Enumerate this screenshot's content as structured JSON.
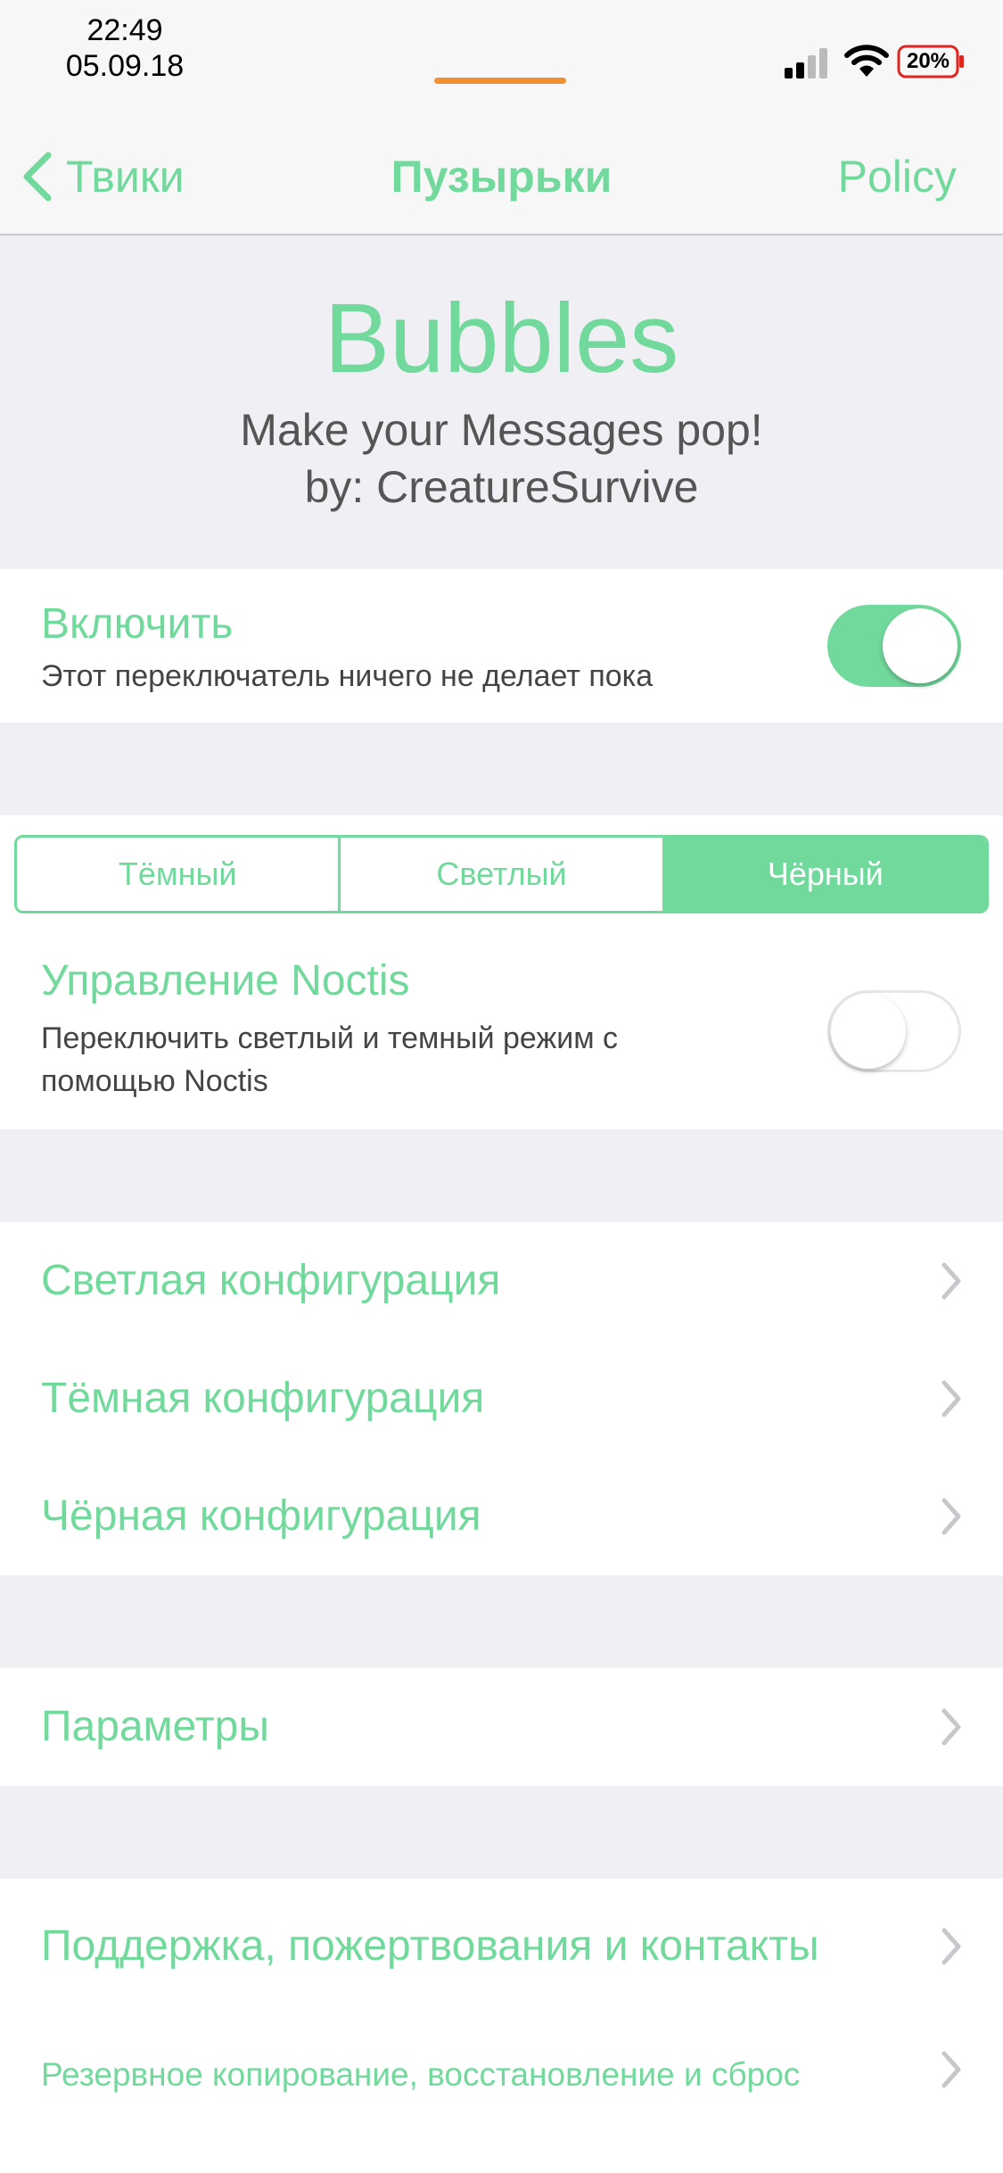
{
  "status_bar": {
    "time": "22:49",
    "date": "05.09.18",
    "battery": "20%"
  },
  "nav": {
    "back_label": "Твики",
    "title": "Пузырьки",
    "right_label": "Policy"
  },
  "header": {
    "app_name": "Bubbles",
    "tagline": "Make your Messages pop!",
    "author": "by: CreatureSurvive"
  },
  "enable": {
    "title": "Включить",
    "subtitle": "Этот переключатель ничего не делает пока",
    "on": true
  },
  "theme": {
    "options": [
      "Тёмный",
      "Светлый",
      "Чёрный"
    ],
    "selected": "Чёрный"
  },
  "noctis": {
    "title": "Управление Noctis",
    "subtitle_line1": "Переключить светлый и темный режим с",
    "subtitle_line2": "помощью Noctis",
    "on": false
  },
  "configs": [
    "Светлая конфигурация",
    "Тёмная конфигурация",
    "Чёрная конфигурация"
  ],
  "params": "Параметры",
  "support": {
    "contacts": "Поддержка, пожертвования и контакты",
    "backup": "Резервное копирование, восстановление и сброс"
  },
  "colors": {
    "accent": "#72d99c",
    "orange": "#f09030",
    "battery_red": "#e0241f"
  }
}
